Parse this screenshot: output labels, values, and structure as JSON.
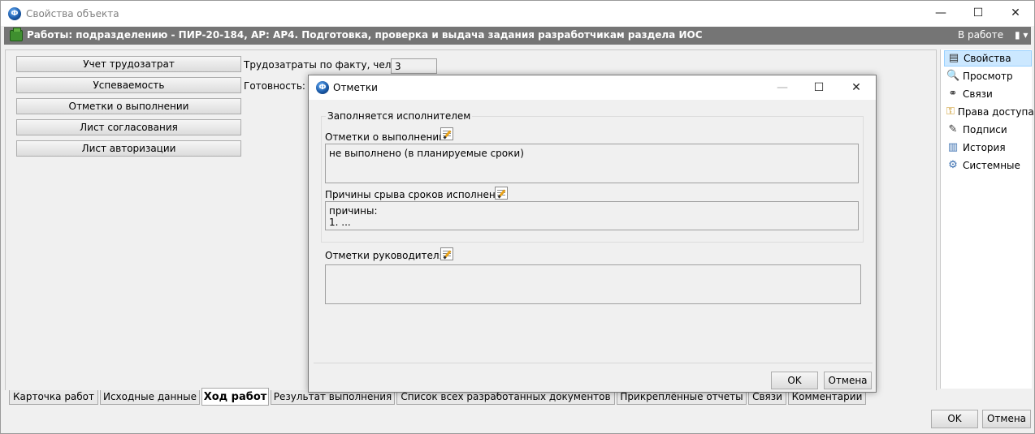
{
  "window": {
    "title": "Свойства объекта",
    "caption_minimize": "—",
    "caption_maximize": "☐",
    "caption_close": "✕"
  },
  "header": {
    "title": "Работы: подразделению - ПИР-20-184, АР: АР4. Подготовка, проверка и выдача задания разработчикам раздела ИОС",
    "status": "В работе",
    "menu_icon": "▮ ▾"
  },
  "left_buttons": [
    "Учет трудозатрат",
    "Успеваемость",
    "Отметки о выполнении",
    "Лист согласования",
    "Лист авторизации"
  ],
  "fields": {
    "labor_label": "Трудозатраты по факту, чел. час",
    "labor_value": "3",
    "readiness_label": "Готовность:"
  },
  "sidebar": {
    "items": [
      {
        "label": "Свойства",
        "icon": "properties-icon",
        "glyph": "▤"
      },
      {
        "label": "Просмотр",
        "icon": "magnifier-icon",
        "glyph": "🔍"
      },
      {
        "label": "Связи",
        "icon": "link-icon",
        "glyph": "⚭"
      },
      {
        "label": "Права доступа",
        "icon": "key-icon",
        "glyph": "⚿"
      },
      {
        "label": "Подписи",
        "icon": "pen-icon",
        "glyph": "✎"
      },
      {
        "label": "История",
        "icon": "history-icon",
        "glyph": "▥"
      },
      {
        "label": "Системные",
        "icon": "system-icon",
        "glyph": "⚙"
      }
    ]
  },
  "tabs": [
    {
      "label": "Карточка работ"
    },
    {
      "label": "Исходные данные"
    },
    {
      "label": "Ход работ"
    },
    {
      "label": "Результат выполнения"
    },
    {
      "label": "Список всех разработанных документов"
    },
    {
      "label": "Прикреплённые отчеты"
    },
    {
      "label": "Связи"
    },
    {
      "label": "Комментарии"
    }
  ],
  "footer": {
    "ok": "OK",
    "cancel": "Отмена"
  },
  "dialog": {
    "title": "Отметки",
    "group_title": "Заполняется исполнителем",
    "marks_label": "Отметки о выполнении",
    "marks_value": "не выполнено (в планируемые сроки)",
    "reasons_label": "Причины срыва сроков исполнения",
    "reasons_value": "причины:\n1. ...",
    "manager_label": "Отметки руководителя:",
    "manager_value": "",
    "ok": "OK",
    "cancel": "Отмена"
  }
}
